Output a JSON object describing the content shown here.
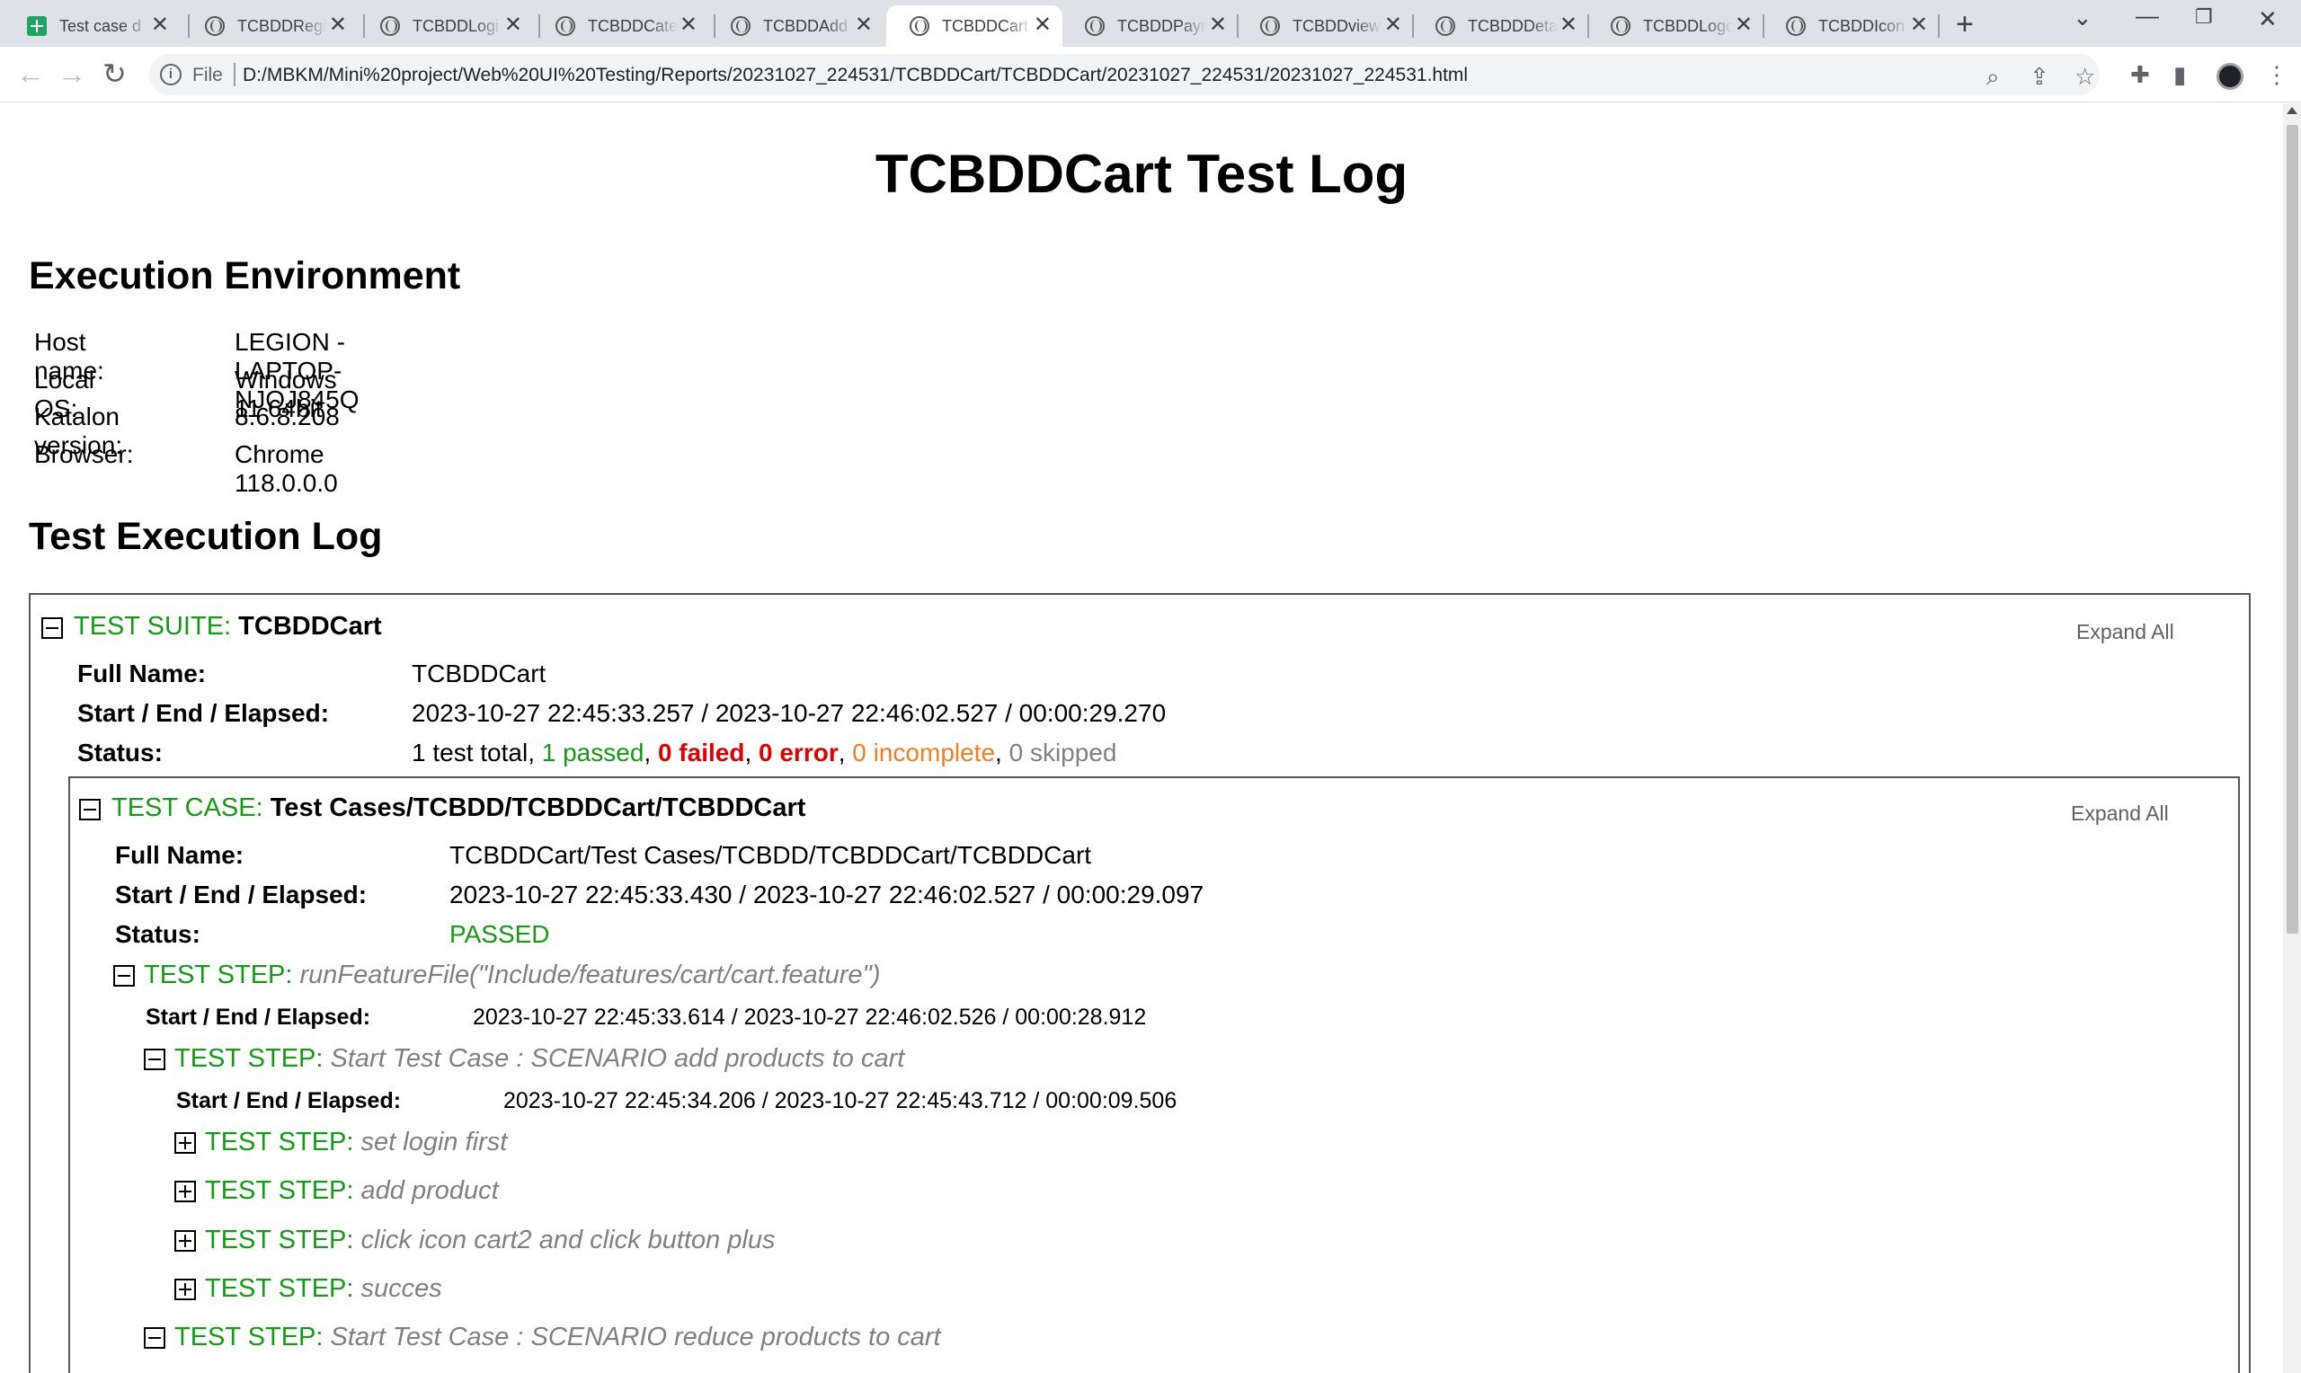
{
  "browser": {
    "tabs": [
      {
        "title": "Test case d",
        "icon": "sheets-icon"
      },
      {
        "title": "TCBDDRegi",
        "icon": "globe-icon"
      },
      {
        "title": "TCBDDLogi",
        "icon": "globe-icon"
      },
      {
        "title": "TCBDDCate",
        "icon": "globe-icon"
      },
      {
        "title": "TCBDDAdd",
        "icon": "globe-icon"
      },
      {
        "title": "TCBDDCart",
        "icon": "globe-icon",
        "active": true
      },
      {
        "title": "TCBDDPaym",
        "icon": "globe-icon"
      },
      {
        "title": "TCBDDview",
        "icon": "globe-icon"
      },
      {
        "title": "TCBDDDeta",
        "icon": "globe-icon"
      },
      {
        "title": "TCBDDLogo",
        "icon": "globe-icon"
      },
      {
        "title": "TCBDDIcon",
        "icon": "globe-icon"
      }
    ],
    "address": {
      "scheme": "File",
      "url": "D:/MBKM/Mini%20project/Web%20UI%20Testing/Reports/20231027_224531/TCBDDCart/TCBDDCart/20231027_224531/20231027_224531.html"
    }
  },
  "report": {
    "title": "TCBDDCart Test Log",
    "env_heading": "Execution Environment",
    "env": [
      {
        "label": "Host name:",
        "value": "LEGION - LAPTOP-NJOJ845Q"
      },
      {
        "label": "Local OS:",
        "value": "Windows 11 64bit"
      },
      {
        "label": "Katalon version:",
        "value": "8.6.8.208"
      },
      {
        "label": "Browser:",
        "value": "Chrome 118.0.0.0"
      }
    ],
    "log_heading": "Test Execution Log",
    "suite": {
      "kind": "TEST SUITE:",
      "name": "TCBDDCart",
      "expand_all": "Expand All",
      "full_name_label": "Full Name:",
      "full_name": "TCBDDCart",
      "time_label": "Start / End / Elapsed:",
      "time": "2023-10-27 22:45:33.257 / 2023-10-27 22:46:02.527 / 00:00:29.270",
      "status_label": "Status:",
      "status": {
        "total": "1 test total",
        "passed": "1 passed",
        "failed": "0 failed",
        "error": "0 error",
        "incomplete": "0 incomplete",
        "skipped": "0 skipped"
      }
    },
    "case": {
      "kind": "TEST CASE:",
      "name": "Test Cases/TCBDD/TCBDDCart/TCBDDCart",
      "expand_all": "Expand All",
      "full_name_label": "Full Name:",
      "full_name": "TCBDDCart/Test Cases/TCBDD/TCBDDCart/TCBDDCart",
      "time_label": "Start / End / Elapsed:",
      "time": "2023-10-27 22:45:33.430 / 2023-10-27 22:46:02.527 / 00:00:29.097",
      "status_label": "Status:",
      "status": "PASSED"
    },
    "steps": {
      "kind": "TEST STEP:",
      "run_feature": {
        "name": "runFeatureFile(\"Include/features/cart/cart.feature\")",
        "time_label": "Start / End / Elapsed:",
        "time": "2023-10-27 22:45:33.614 / 2023-10-27 22:46:02.526 / 00:00:28.912"
      },
      "scenario1": {
        "name": "Start Test Case : SCENARIO add products to cart",
        "time_label": "Start / End / Elapsed:",
        "time": "2023-10-27 22:45:34.206 / 2023-10-27 22:45:43.712 / 00:00:09.506"
      },
      "children": [
        {
          "name": "set login first"
        },
        {
          "name": "add product"
        },
        {
          "name": "click icon cart2 and click button plus"
        },
        {
          "name": "succes"
        }
      ],
      "scenario2": {
        "name": "Start Test Case : SCENARIO reduce products to cart"
      }
    }
  }
}
